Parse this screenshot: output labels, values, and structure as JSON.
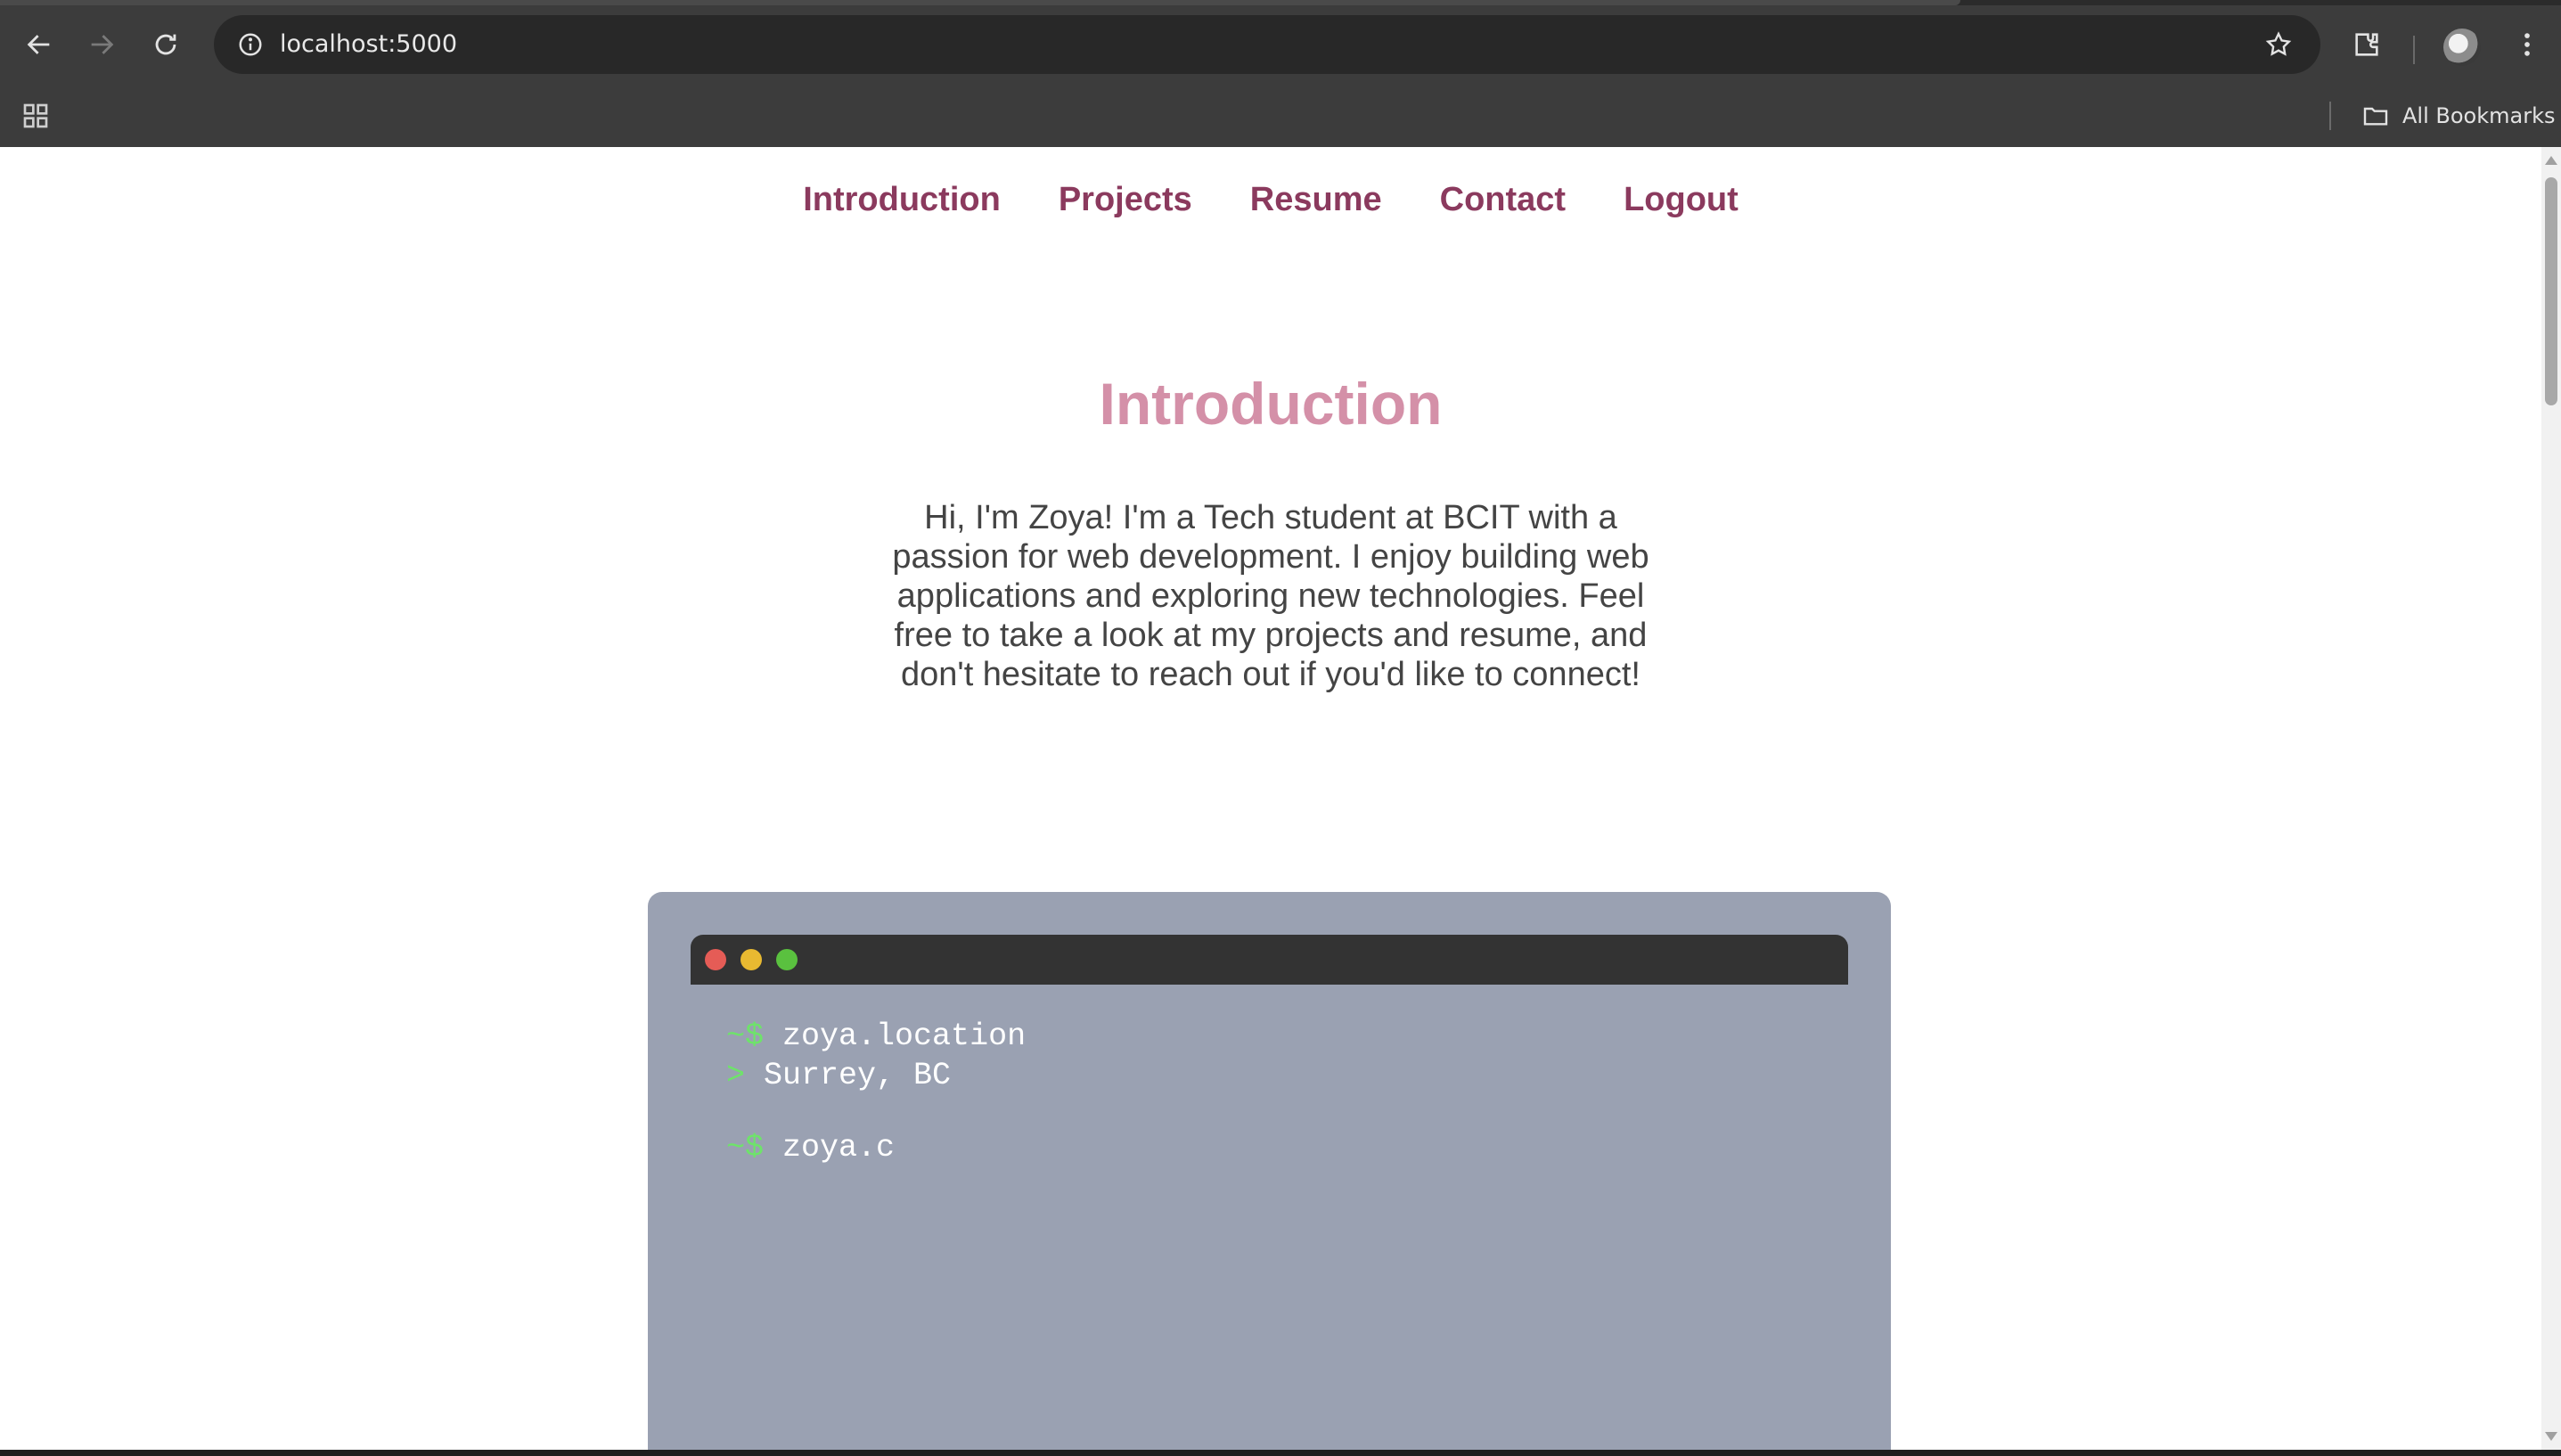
{
  "browser": {
    "url": "localhost:5000",
    "bookmarks_label": "All Bookmarks"
  },
  "nav": {
    "items": [
      "Introduction",
      "Projects",
      "Resume",
      "Contact",
      "Logout"
    ]
  },
  "main": {
    "title": "Introduction",
    "intro": "Hi, I'm Zoya! I'm a Tech student at BCIT with a passion for web development. I enjoy building web applications and exploring new technologies. Feel free to take a look at my projects and resume, and don't hesitate to reach out if you'd like to connect!"
  },
  "terminal": {
    "prompt": "~$",
    "output_marker": ">",
    "lines": [
      {
        "command": "zoya.location",
        "output": "Surrey, BC"
      },
      {
        "command": "zoya.c"
      }
    ]
  },
  "colors": {
    "nav_link": "#8b3a5e",
    "title": "#d490a8",
    "terminal_card": "#9aa1b2",
    "terminal_prompt": "#6ee36a"
  }
}
